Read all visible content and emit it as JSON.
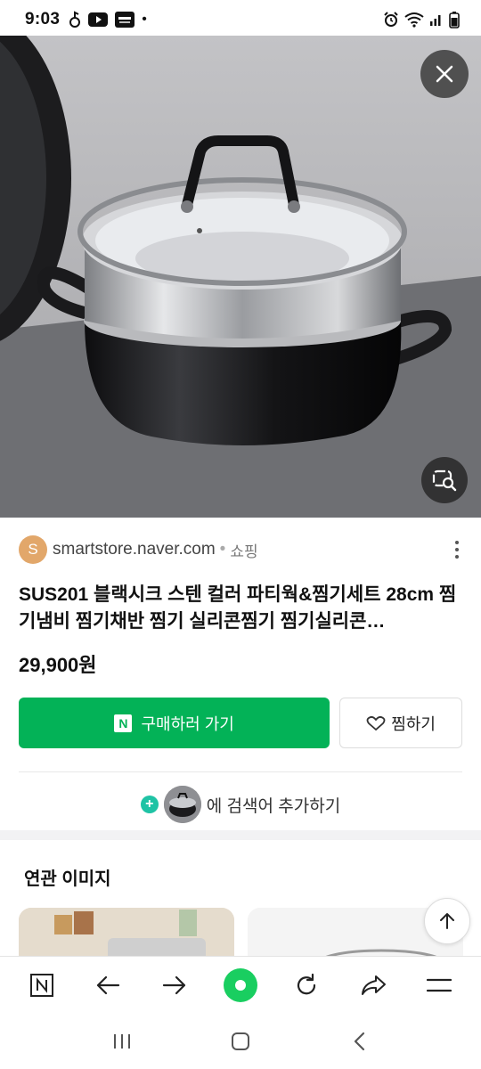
{
  "status_bar": {
    "time": "9:03",
    "left_icons": [
      "notification-icon",
      "youtube-icon",
      "kia-connect-icon"
    ],
    "extra": "•",
    "right_icons": [
      "alarm-icon",
      "wifi-icon",
      "signal-icon",
      "battery-icon"
    ]
  },
  "hero": {
    "close_icon": "close-icon",
    "lens_icon": "image-search-icon"
  },
  "result": {
    "source_initial": "S",
    "source_domain": "smartstore.naver.com",
    "source_separator": "•",
    "source_type": "쇼핑",
    "title": "SUS201 블랙시크 스텐 컬러 파티웍&찜기세트 28cm 찜기냄비 찜기채반 찜기 실리콘찜기 찜기실리콘…",
    "price": "29,900원",
    "buy_button_logo": "N",
    "buy_button_label": "구매하러 가기",
    "wish_button_label": "찜하기",
    "add_plus": "+",
    "add_label": "에 검색어 추가하기"
  },
  "related": {
    "title": "연관 이미지"
  },
  "toolbar": {
    "items": [
      "naver-home-icon",
      "back-icon",
      "forward-icon",
      "green-dot-icon",
      "refresh-icon",
      "share-icon",
      "menu-icon"
    ]
  },
  "system_nav": {
    "items": [
      "recent-apps-icon",
      "home-icon",
      "back-icon"
    ]
  },
  "colors": {
    "buy_green": "#03b257",
    "home_green": "#19ce60",
    "plus_teal": "#1fc3a5"
  }
}
